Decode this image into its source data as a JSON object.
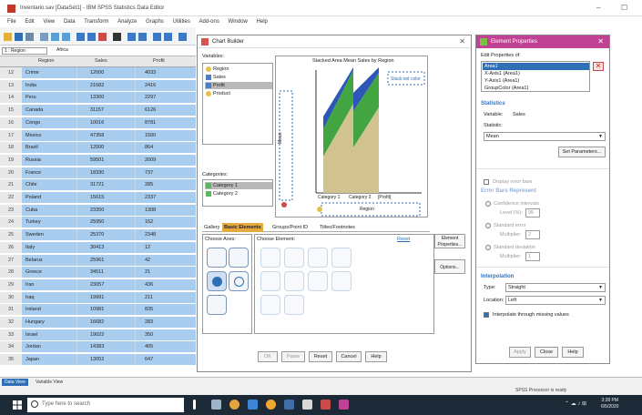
{
  "window": {
    "title": "Inventario.sav [DataSet1] - IBM SPSS Statistics Data Editor",
    "minimize": "–",
    "maximize": "☐"
  },
  "menu": [
    "File",
    "Edit",
    "View",
    "Data",
    "Transform",
    "Analyze",
    "Graphs",
    "Utilities",
    "Add-ons",
    "Window",
    "Help"
  ],
  "cellbar": {
    "ref": "1 : Region",
    "value": "Africa"
  },
  "grid": {
    "headers": [
      "Region",
      "Sales",
      "Profit"
    ],
    "rows": [
      {
        "n": "12",
        "region": "Crime",
        "sales": "12000",
        "profit": "4033"
      },
      {
        "n": "13",
        "region": "India",
        "sales": "21682",
        "profit": "2416"
      },
      {
        "n": "14",
        "region": "Peru",
        "sales": "13300",
        "profit": "2297"
      },
      {
        "n": "15",
        "region": "Canada",
        "sales": "31157",
        "profit": "6126"
      },
      {
        "n": "16",
        "region": "Congo",
        "sales": "10016",
        "profit": "8781"
      },
      {
        "n": "17",
        "region": "Mexico",
        "sales": "47358",
        "profit": "1500"
      },
      {
        "n": "18",
        "region": "Brazil",
        "sales": "12000",
        "profit": "864"
      },
      {
        "n": "19",
        "region": "Russia",
        "sales": "59501",
        "profit": "2009"
      },
      {
        "n": "20",
        "region": "France",
        "sales": "18330",
        "profit": "737"
      },
      {
        "n": "21",
        "region": "Chile",
        "sales": "31721",
        "profit": "285"
      },
      {
        "n": "22",
        "region": "Poland",
        "sales": "15615",
        "profit": "2337"
      },
      {
        "n": "23",
        "region": "Cuba",
        "sales": "23350",
        "profit": "1308"
      },
      {
        "n": "24",
        "region": "Turkey",
        "sales": "25950",
        "profit": "162"
      },
      {
        "n": "25",
        "region": "Sweden",
        "sales": "25370",
        "profit": "2348"
      },
      {
        "n": "26",
        "region": "Italy",
        "sales": "30413",
        "profit": "12"
      },
      {
        "n": "27",
        "region": "Belarus",
        "sales": "25961",
        "profit": "42"
      },
      {
        "n": "28",
        "region": "Greece",
        "sales": "34511",
        "profit": "21"
      },
      {
        "n": "29",
        "region": "Iran",
        "sales": "23057",
        "profit": "436"
      },
      {
        "n": "30",
        "region": "Iraq",
        "sales": "19991",
        "profit": "211"
      },
      {
        "n": "31",
        "region": "Ireland",
        "sales": "10981",
        "profit": "835"
      },
      {
        "n": "32",
        "region": "Hungary",
        "sales": "16682",
        "profit": "283"
      },
      {
        "n": "33",
        "region": "Israel",
        "sales": "19022",
        "profit": "350"
      },
      {
        "n": "34",
        "region": "Jordan",
        "sales": "14383",
        "profit": "405"
      },
      {
        "n": "35",
        "region": "Japan",
        "sales": "13052",
        "profit": "647"
      }
    ]
  },
  "bottom_tabs": {
    "data_view": "Data View",
    "variable_view": "Variable View"
  },
  "status": {
    "text": "SPSS Processor is ready"
  },
  "taskbar": {
    "search_placeholder": "Type here to search",
    "time": "3:28 PM",
    "date": "6/5/2020"
  },
  "chart_builder": {
    "title": "Chart Builder",
    "variables_label": "Variables:",
    "variables": [
      "Region",
      "Sales",
      "Profit",
      "Product"
    ],
    "canvas_title": "Stacked Area Mean Sales by Region",
    "legend_label": "Stack:set color",
    "y_axis_label": "Mean",
    "x_axis_label": "Region",
    "x_categories": [
      "Category 1",
      "Category 2",
      "[Profit]"
    ],
    "categories_label": "Categories:",
    "categories": [
      "Category 1",
      "Category 2"
    ],
    "tabs": [
      "Gallery",
      "Basic Elements",
      "Groups/Point ID",
      "Titles/Footnotes"
    ],
    "axes_label": "Choose Axes:",
    "elements_label": "Choose Element:",
    "side_buttons": [
      "Element Properties...",
      "Options..."
    ],
    "dialog_buttons": [
      "OK",
      "Paste",
      "Reset",
      "Cancel",
      "Help"
    ],
    "reset_link": "Reset"
  },
  "element_properties": {
    "title": "Element Properties",
    "edit_label": "Edit Properties of:",
    "elements": [
      "Area1",
      "X-Axis1 (Area1)",
      "Y-Axis1 (Area1)",
      "GroupColor (Area1)"
    ],
    "statistics_header": "Statistics",
    "variable_label": "Variable:",
    "variable_value": "Sales",
    "statistic_label": "Statistic:",
    "statistic_value": "Mean",
    "set_params": "Set Parameters...",
    "error_bars_label": "Display error bars",
    "error_bars_represent": "Error Bars Represent",
    "ci_label": "Confidence intervals",
    "ci_level_label": "Level (%):",
    "ci_level": "95",
    "se_label": "Standard error",
    "se_mult_label": "Multiplier:",
    "se_mult": "2",
    "sd_label": "Standard deviation",
    "sd_mult_label": "Multiplier:",
    "sd_mult": "1",
    "interpolation_header": "Interpolation",
    "type_label": "Type:",
    "type_value": "Straight",
    "location_label": "Location:",
    "location_value": "Left",
    "interp_missing_label": "Interpolate through missing values",
    "buttons": [
      "Apply",
      "Close",
      "Help"
    ]
  }
}
